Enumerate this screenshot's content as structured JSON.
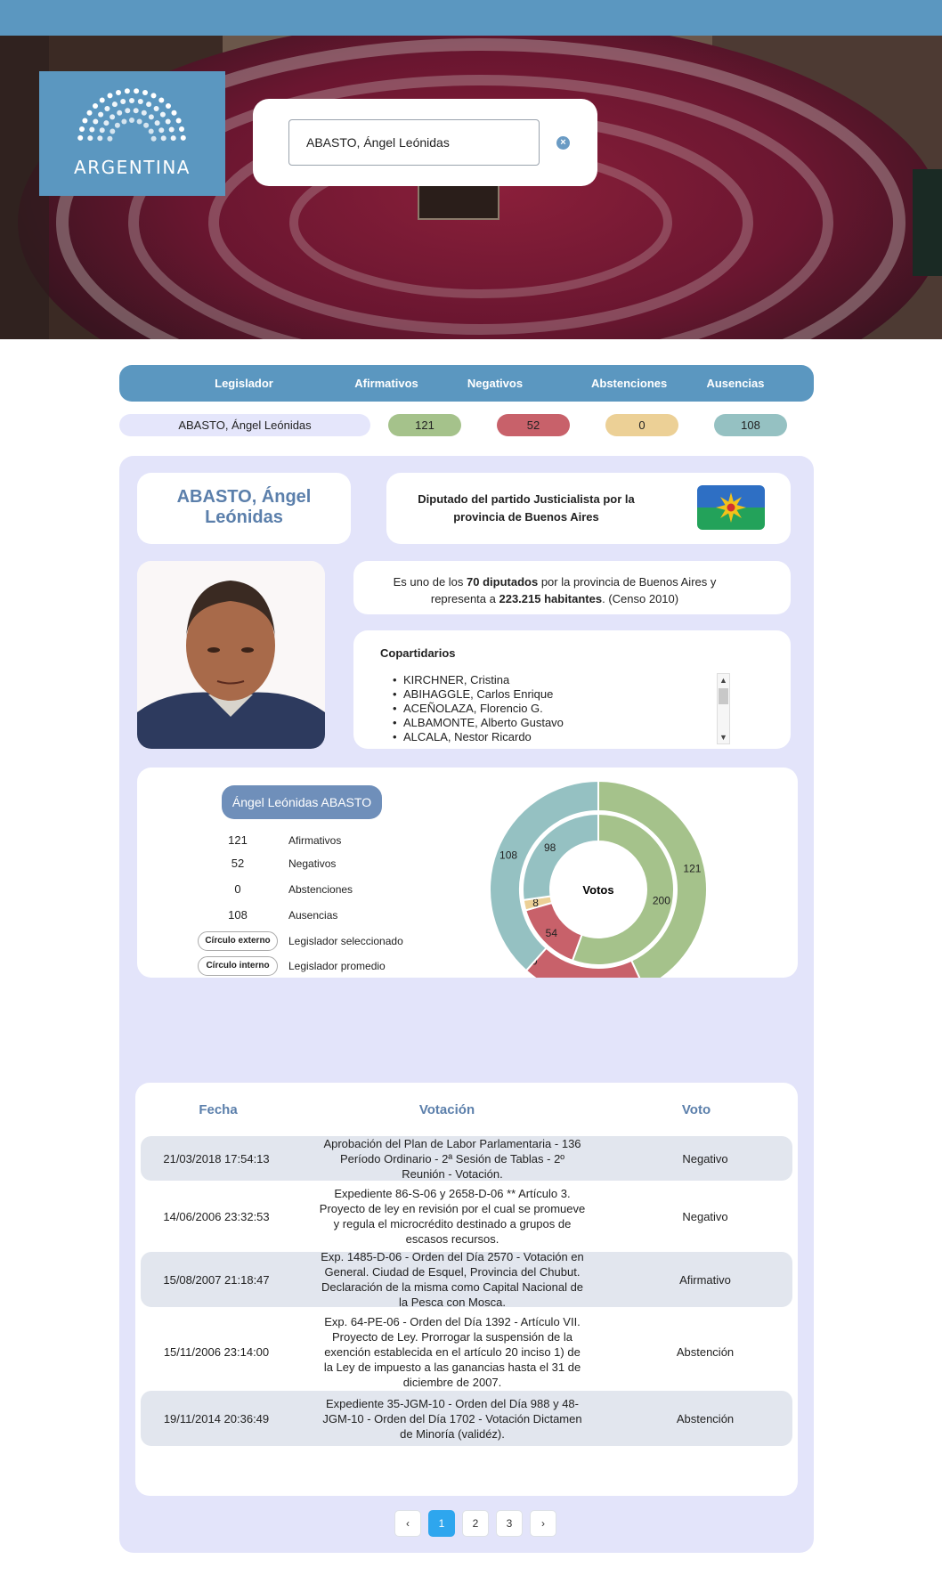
{
  "brand": {
    "logo_text": "ARGENTINA"
  },
  "search": {
    "value": "ABASTO, Ángel Leónidas",
    "clear_icon": "clear-circle-icon"
  },
  "summary": {
    "headers": {
      "legislador": "Legislador",
      "afirmativos": "Afirmativos",
      "negativos": "Negativos",
      "abstenciones": "Abstenciones",
      "ausencias": "Ausencias"
    },
    "row": {
      "name": "ABASTO, Ángel Leónidas",
      "afirmativos": "121",
      "negativos": "52",
      "abstenciones": "0",
      "ausencias": "108"
    }
  },
  "profile": {
    "name_line1": "ABASTO, Ángel",
    "name_line2": "Leónidas",
    "party_line1": "Diputado del partido Justicialista por la",
    "party_line2": "provincia de Buenos Aires",
    "rep": {
      "pre": "Es uno de los ",
      "count": "70 diputados",
      "mid": " por la provincia de Buenos Aires y representa a ",
      "inhabitants": "223.215 habitantes",
      "post": ". (Censo 2010)"
    },
    "copartidarios_title": "Copartidarios",
    "copartidarios": [
      "KIRCHNER, Cristina",
      "ABIHAGGLE, Carlos Enrique",
      "ACEÑOLAZA, Florencio G.",
      "ALBAMONTE, Alberto Gustavo",
      "ALCALA, Nestor Ricardo"
    ]
  },
  "legend": {
    "name": "Ángel Leónidas ABASTO",
    "items": [
      {
        "value": "121",
        "label": "Afirmativos",
        "color": "#a5c28b"
      },
      {
        "value": "52",
        "label": "Negativos",
        "color": "#c8616a"
      },
      {
        "value": "0",
        "label": "Abstenciones",
        "color": "#ecd096"
      },
      {
        "value": "108",
        "label": "Ausencias",
        "color": "#95c1c2"
      }
    ],
    "outer": {
      "pill": "Círculo externo",
      "label": "Legislador seleccionado"
    },
    "inner": {
      "pill": "Círculo interno",
      "label": "Legislador promedio"
    }
  },
  "chart_data": {
    "type": "pie",
    "title": "Votos",
    "categories": [
      "Afirmativos",
      "Negativos",
      "Abstenciones",
      "Ausencias"
    ],
    "series": [
      {
        "name": "Legislador seleccionado",
        "values": [
          121,
          52,
          0,
          108
        ]
      },
      {
        "name": "Legislador promedio",
        "values": [
          200,
          54,
          8,
          98
        ]
      }
    ],
    "colors": [
      "#a5c28b",
      "#c8616a",
      "#ecd096",
      "#95c1c2"
    ]
  },
  "votes": {
    "headers": {
      "fecha": "Fecha",
      "votacion": "Votación",
      "voto": "Voto"
    },
    "rows": [
      {
        "fecha": "21/03/2018 17:54:13",
        "votacion": "Aprobación del Plan de Labor Parlamentaria - 136 Período Ordinario - 2ª Sesión de Tablas - 2º Reunión - Votación.",
        "voto": "Negativo"
      },
      {
        "fecha": "14/06/2006 23:32:53",
        "votacion": "Expediente 86-S-06 y 2658-D-06 ** Artículo 3. Proyecto de ley en revisión por el cual se promueve y regula el microcrédito destinado a grupos de escasos recursos.",
        "voto": "Negativo"
      },
      {
        "fecha": "15/08/2007 21:18:47",
        "votacion": "Exp. 1485-D-06 - Orden del Día 2570 - Votación en General. Ciudad de Esquel, Provincia del Chubut. Declaración de la misma como Capital Nacional de la Pesca con Mosca.",
        "voto": "Afirmativo"
      },
      {
        "fecha": "15/11/2006 23:14:00",
        "votacion": "Exp. 64-PE-06 - Orden del Día 1392 - Artículo VII. Proyecto de Ley. Prorrogar la suspensión de la exención establecida en el artículo 20 inciso 1) de la Ley de impuesto a las ganancias hasta el 31 de diciembre de 2007.",
        "voto": "Abstención"
      },
      {
        "fecha": "19/11/2014 20:36:49",
        "votacion": "Expediente 35-JGM-10 - Orden del Día 988 y 48-JGM-10 - Orden del Día 1702 - Votación Dictamen de Minoría (validéz).",
        "voto": "Abstención"
      }
    ]
  },
  "pagination": {
    "prev": "‹",
    "pages": [
      "1",
      "2",
      "3"
    ],
    "current": "1",
    "next": "›"
  }
}
